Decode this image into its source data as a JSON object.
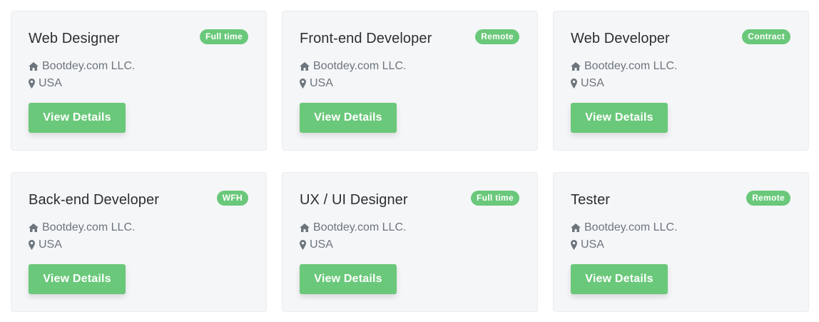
{
  "colors": {
    "accent": "#6ac87a",
    "card_bg": "#f5f6f8",
    "title": "#2b2f33",
    "meta": "#6c757d"
  },
  "jobs": [
    {
      "title": "Web Designer",
      "badge": "Full time",
      "company": "Bootdey.com LLC.",
      "location": "USA",
      "button": "View Details"
    },
    {
      "title": "Front-end Developer",
      "badge": "Remote",
      "company": "Bootdey.com LLC.",
      "location": "USA",
      "button": "View Details"
    },
    {
      "title": "Web Developer",
      "badge": "Contract",
      "company": "Bootdey.com LLC.",
      "location": "USA",
      "button": "View Details"
    },
    {
      "title": "Back-end Developer",
      "badge": "WFH",
      "company": "Bootdey.com LLC.",
      "location": "USA",
      "button": "View Details"
    },
    {
      "title": "UX / UI Designer",
      "badge": "Full time",
      "company": "Bootdey.com LLC.",
      "location": "USA",
      "button": "View Details"
    },
    {
      "title": "Tester",
      "badge": "Remote",
      "company": "Bootdey.com LLC.",
      "location": "USA",
      "button": "View Details"
    }
  ],
  "icons": {
    "company": "home-icon",
    "location": "map-marker-icon"
  }
}
